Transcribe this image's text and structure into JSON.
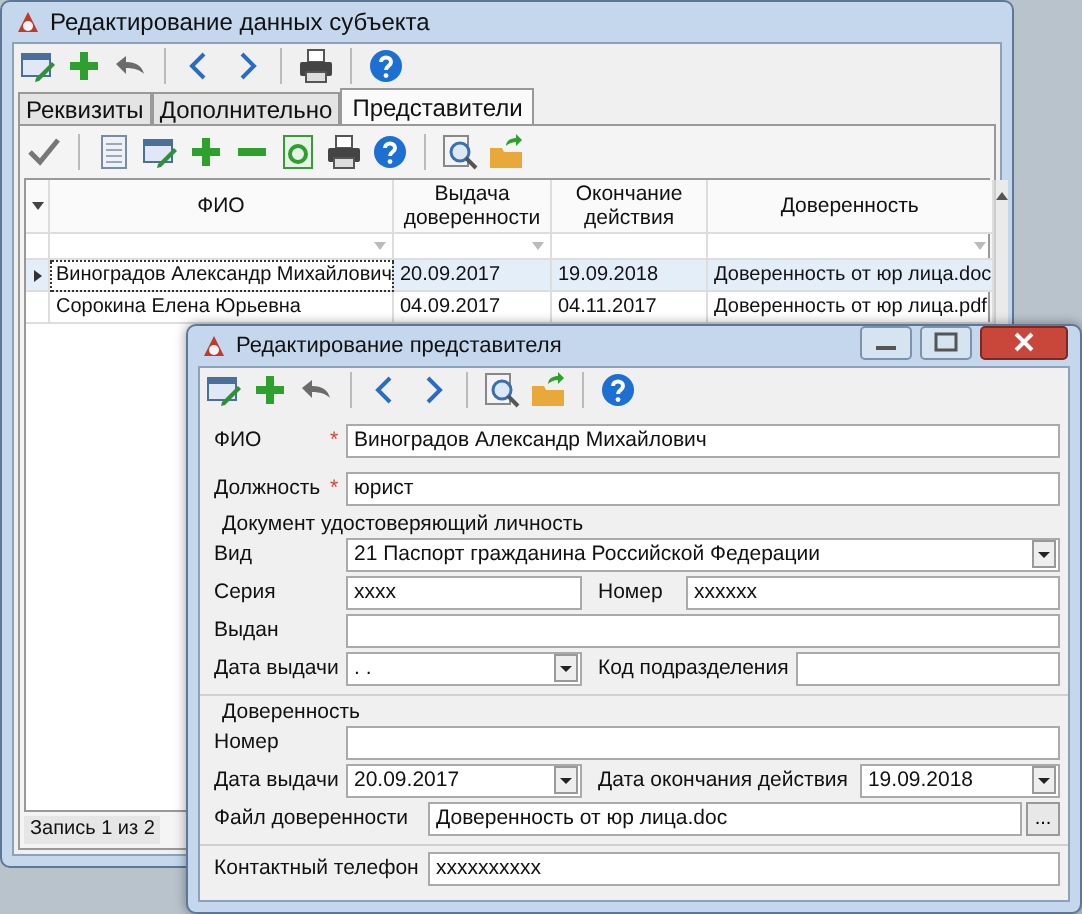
{
  "main_window": {
    "title": "Редактирование данных субъекта",
    "tabs": [
      {
        "label": "Реквизиты",
        "selected": false
      },
      {
        "label": "Дополнительно",
        "selected": false
      },
      {
        "label": "Представители",
        "selected": true
      }
    ],
    "table": {
      "columns": [
        "ФИО",
        "Выдача доверенности",
        "Окончание действия",
        "Доверенность"
      ],
      "rows": [
        {
          "selected": true,
          "cells": [
            "Виноградов Александр Михайлович",
            "20.09.2017",
            "19.09.2018",
            "Доверенность от юр лица.doc"
          ]
        },
        {
          "selected": false,
          "cells": [
            "Сорокина Елена Юрьевна",
            "04.09.2017",
            "04.11.2017",
            "Доверенность от юр лица.pdf"
          ]
        }
      ]
    },
    "status_bar": "Запись 1 из 2"
  },
  "dialog": {
    "title": "Редактирование представителя",
    "fio": {
      "label": "ФИО",
      "required_mark": "*",
      "value": "Виноградов Александр Михайлович"
    },
    "position": {
      "label": "Должность",
      "required_mark": "*",
      "value": "юрист"
    },
    "identity_document": {
      "heading": "Документ удостоверяющий личность",
      "type": {
        "label": "Вид",
        "value": "21 Паспорт гражданина Российской Федерации"
      },
      "series": {
        "label": "Серия",
        "value": "xxxx"
      },
      "number": {
        "label": "Номер",
        "value": "xxxxxx"
      },
      "issued_by": {
        "label": "Выдан"
      },
      "issue_date": {
        "label": "Дата выдачи",
        "value": ". ."
      },
      "department_code": {
        "label": "Код подразделения"
      }
    },
    "power_of_attorney": {
      "heading": "Доверенность",
      "number": {
        "label": "Номер"
      },
      "issue_date": {
        "label": "Дата выдачи",
        "value": "20.09.2017"
      },
      "end_date": {
        "label": "Дата окончания действия",
        "value": "19.09.2018"
      },
      "file": {
        "label": "Файл доверенности",
        "value": "Доверенность от юр лица.doc",
        "browse_button": "..."
      }
    },
    "phone": {
      "label": "Контактный телефон",
      "value": "xxxxxxxxxx"
    }
  }
}
